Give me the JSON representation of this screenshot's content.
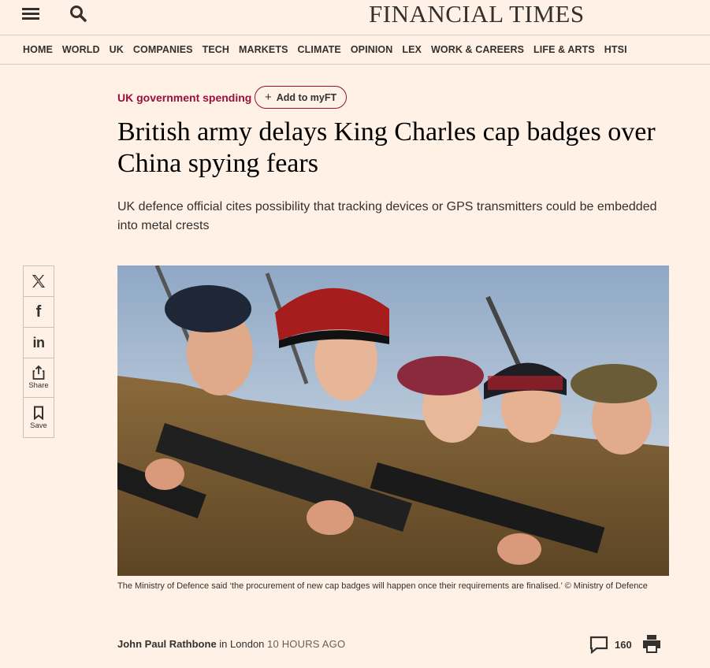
{
  "header": {
    "masthead": "FINANCIAL TIMES"
  },
  "nav": {
    "items": [
      "HOME",
      "WORLD",
      "UK",
      "COMPANIES",
      "TECH",
      "MARKETS",
      "CLIMATE",
      "OPINION",
      "LEX",
      "WORK & CAREERS",
      "LIFE & ARTS",
      "HTSI"
    ]
  },
  "article": {
    "topic": "UK government spending",
    "myft_label": "Add to myFT",
    "headline": "British army delays King Charles cap badges over China spying fears",
    "standfirst": "UK defence official cites possibility that tracking devices or GPS transmitters could be embedded into metal crests",
    "caption": "The Ministry of Defence said ‘the procurement of new cap badges will happen once their requirements are finalised.’ © Ministry of Defence",
    "byline": {
      "author": "John Paul Rathbone",
      "location_prefix": "in London",
      "time": "10 HOURS AGO"
    },
    "comments_count": "160"
  },
  "sharebar": {
    "x_glyph": "𝕏",
    "facebook_glyph": "f",
    "linkedin_glyph": "in",
    "share_label": "Share",
    "save_label": "Save"
  },
  "colors": {
    "background": "#fff1e5",
    "topic": "#990f3d",
    "text": "#33302e"
  }
}
